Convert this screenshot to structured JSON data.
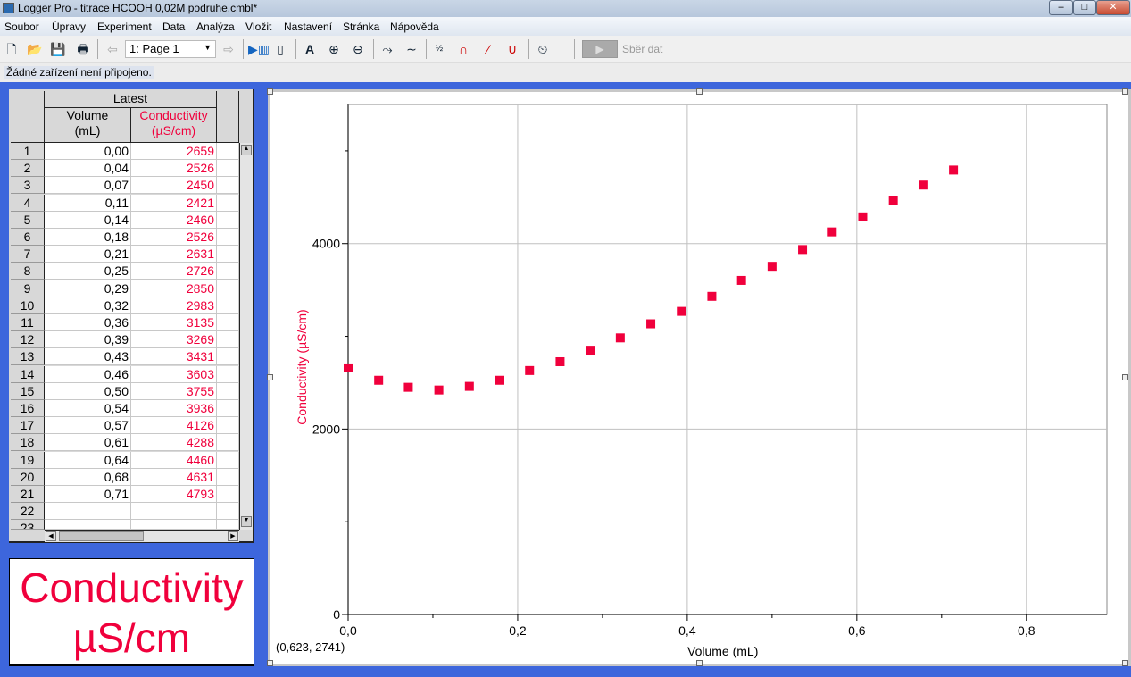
{
  "window": {
    "title": "Logger Pro - titrace HCOOH 0,02M podruhe.cmbl*",
    "min": "–",
    "max": "□",
    "close": "✕"
  },
  "menu": [
    "Soubor",
    "Úpravy",
    "Experiment",
    "Data",
    "Analýza",
    "Vložit",
    "Nastavení",
    "Stránka",
    "Nápověda"
  ],
  "toolbar": {
    "page_select": "1: Page 1",
    "collect_label": "Sběr dat",
    "icons": [
      "new-file",
      "open-folder",
      "save",
      "print",
      "prev-page",
      "page-select",
      "next-page",
      "table-view",
      "interface",
      "autoscale",
      "zoom-in",
      "zoom-out",
      "examine",
      "tangent",
      "statistics",
      "integral",
      "linear-fit",
      "curve-fit",
      "stopwatch"
    ]
  },
  "status": "Žádné zařízení není připojeno.",
  "table": {
    "group": "Latest",
    "columns": [
      {
        "name": "Volume",
        "unit": "(mL)"
      },
      {
        "name": "Conductivity",
        "unit": "(µS/cm)"
      }
    ],
    "rows": [
      [
        "0,00",
        "2659"
      ],
      [
        "0,04",
        "2526"
      ],
      [
        "0,07",
        "2450"
      ],
      [
        "0,11",
        "2421"
      ],
      [
        "0,14",
        "2460"
      ],
      [
        "0,18",
        "2526"
      ],
      [
        "0,21",
        "2631"
      ],
      [
        "0,25",
        "2726"
      ],
      [
        "0,29",
        "2850"
      ],
      [
        "0,32",
        "2983"
      ],
      [
        "0,36",
        "3135"
      ],
      [
        "0,39",
        "3269"
      ],
      [
        "0,43",
        "3431"
      ],
      [
        "0,46",
        "3603"
      ],
      [
        "0,50",
        "3755"
      ],
      [
        "0,54",
        "3936"
      ],
      [
        "0,57",
        "4126"
      ],
      [
        "0,61",
        "4288"
      ],
      [
        "0,64",
        "4460"
      ],
      [
        "0,68",
        "4631"
      ],
      [
        "0,71",
        "4793"
      ],
      [
        "",
        ""
      ],
      [
        "",
        ""
      ]
    ]
  },
  "meter": {
    "line1": "Conductivity",
    "line2": "µS/cm"
  },
  "coords": "(0,623, 2741)",
  "colors": {
    "series": "#f0003c",
    "background": "#3d66dc"
  },
  "chart_data": {
    "type": "scatter",
    "xlabel": "Volume (mL)",
    "ylabel": "Conductivity (µS/cm)",
    "xlim": [
      0,
      0.895
    ],
    "ylim": [
      0,
      5500
    ],
    "grid": true,
    "xticks": [
      "0,0",
      "0,2",
      "0,4",
      "0,6",
      "0,8"
    ],
    "yticks": [
      "0",
      "2000",
      "4000"
    ],
    "x": [
      0.0,
      0.036,
      0.071,
      0.107,
      0.143,
      0.179,
      0.214,
      0.25,
      0.286,
      0.321,
      0.357,
      0.393,
      0.429,
      0.464,
      0.5,
      0.536,
      0.571,
      0.607,
      0.643,
      0.679,
      0.714
    ],
    "y": [
      2659,
      2526,
      2450,
      2421,
      2460,
      2526,
      2631,
      2726,
      2850,
      2983,
      3135,
      3269,
      3431,
      3603,
      3755,
      3936,
      4126,
      4288,
      4460,
      4631,
      4793
    ]
  }
}
